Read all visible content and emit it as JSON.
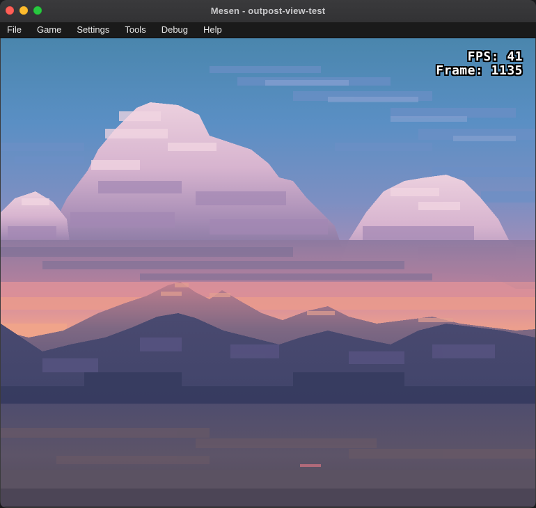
{
  "window": {
    "title": "Mesen - outpost-view-test"
  },
  "menu": {
    "items": [
      {
        "label": "File"
      },
      {
        "label": "Game"
      },
      {
        "label": "Settings"
      },
      {
        "label": "Tools"
      },
      {
        "label": "Debug"
      },
      {
        "label": "Help"
      }
    ]
  },
  "overlay": {
    "fps_label": "FPS: 41",
    "frame_label": "Frame: 1135"
  },
  "colors": {
    "sky_top": "#4f86b0",
    "cloud_light": "#e6c4d4",
    "cloud_shadow": "#b794bd",
    "sunset_band": "#e79a8c",
    "mountain_dark": "#44476b",
    "ground": "#5e5460"
  }
}
